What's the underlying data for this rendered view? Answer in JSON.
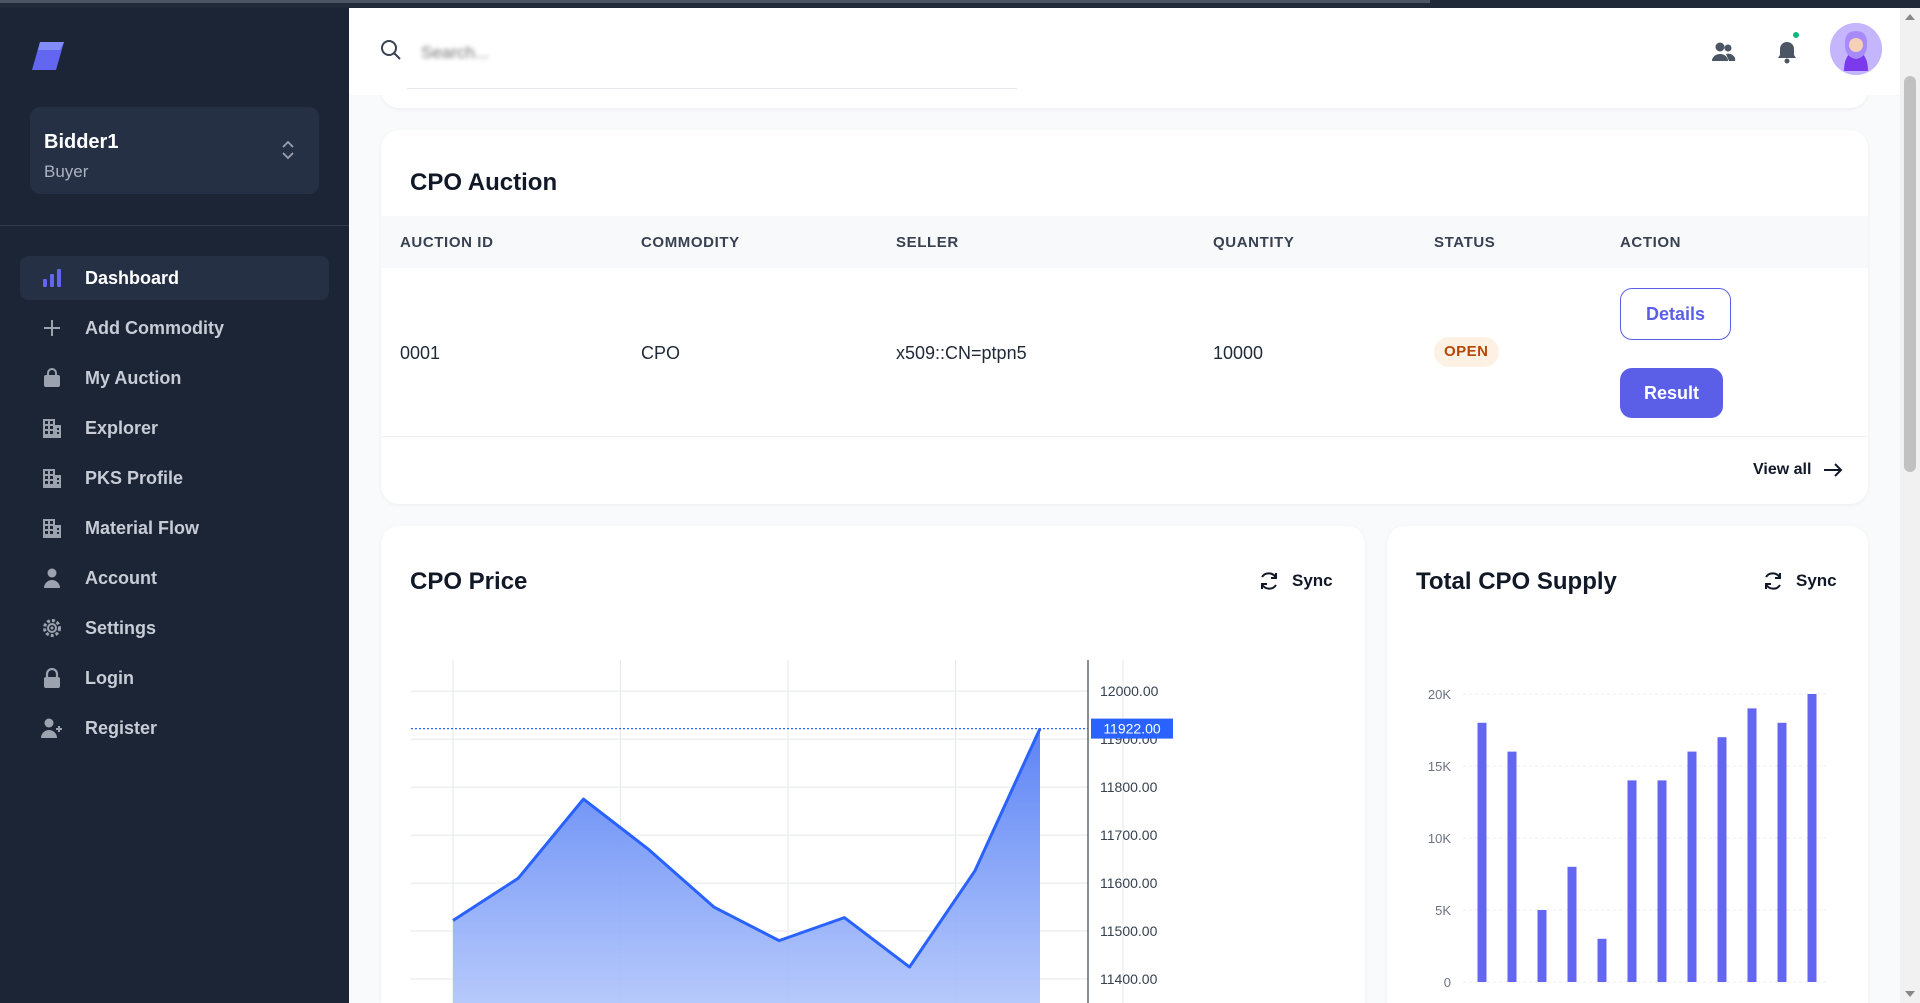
{
  "account": {
    "name": "Bidder1",
    "role": "Buyer"
  },
  "nav": [
    {
      "label": "Dashboard",
      "icon": "bar-chart-icon",
      "active": true
    },
    {
      "label": "Add Commodity",
      "icon": "plus-icon"
    },
    {
      "label": "My Auction",
      "icon": "shopping-bag-icon"
    },
    {
      "label": "Explorer",
      "icon": "building-icon"
    },
    {
      "label": "PKS Profile",
      "icon": "building-icon"
    },
    {
      "label": "Material Flow",
      "icon": "building-icon"
    },
    {
      "label": "Account",
      "icon": "user-icon"
    },
    {
      "label": "Settings",
      "icon": "gear-icon"
    },
    {
      "label": "Login",
      "icon": "lock-icon"
    },
    {
      "label": "Register",
      "icon": "user-plus-icon"
    }
  ],
  "search": {
    "placeholder": "Search..."
  },
  "auction": {
    "title": "CPO Auction",
    "columns": [
      "AUCTION ID",
      "COMMODITY",
      "SELLER",
      "QUANTITY",
      "STATUS",
      "ACTION"
    ],
    "rows": [
      {
        "id": "0001",
        "commodity": "CPO",
        "seller": "x509::CN=ptpn5",
        "quantity": "10000",
        "status": "OPEN"
      }
    ],
    "details_label": "Details",
    "result_label": "Result",
    "view_all_label": "View all"
  },
  "colors": {
    "accent": "#5b5fe8",
    "sidebar": "#1c2536",
    "line": "#2962ff",
    "status_open_bg": "#fdf1e3",
    "status_open_text": "#b54708"
  },
  "price_card": {
    "title": "CPO Price",
    "sync_label": "Sync"
  },
  "supply_card": {
    "title": "Total CPO Supply",
    "sync_label": "Sync"
  },
  "chart_data": [
    {
      "type": "area",
      "title": "CPO Price",
      "y_ticks": [
        "12000.00",
        "11900.00",
        "11800.00",
        "11700.00",
        "11600.00",
        "11500.00",
        "11400.00"
      ],
      "values": [
        11522,
        11610,
        11775,
        11670,
        11550,
        11480,
        11528,
        11425,
        11625,
        11922
      ],
      "last_value_label": "11922.00",
      "ylim": [
        11350,
        12065
      ],
      "grid": true
    },
    {
      "type": "bar",
      "title": "Total CPO Supply",
      "y_ticks": [
        "20K",
        "15K",
        "10K",
        "5K",
        "0"
      ],
      "values": [
        18000,
        16000,
        5000,
        8000,
        3000,
        14000,
        14000,
        16000,
        17000,
        19000,
        18000,
        20000
      ],
      "ylim": [
        0,
        20000
      ],
      "grid": true
    }
  ]
}
